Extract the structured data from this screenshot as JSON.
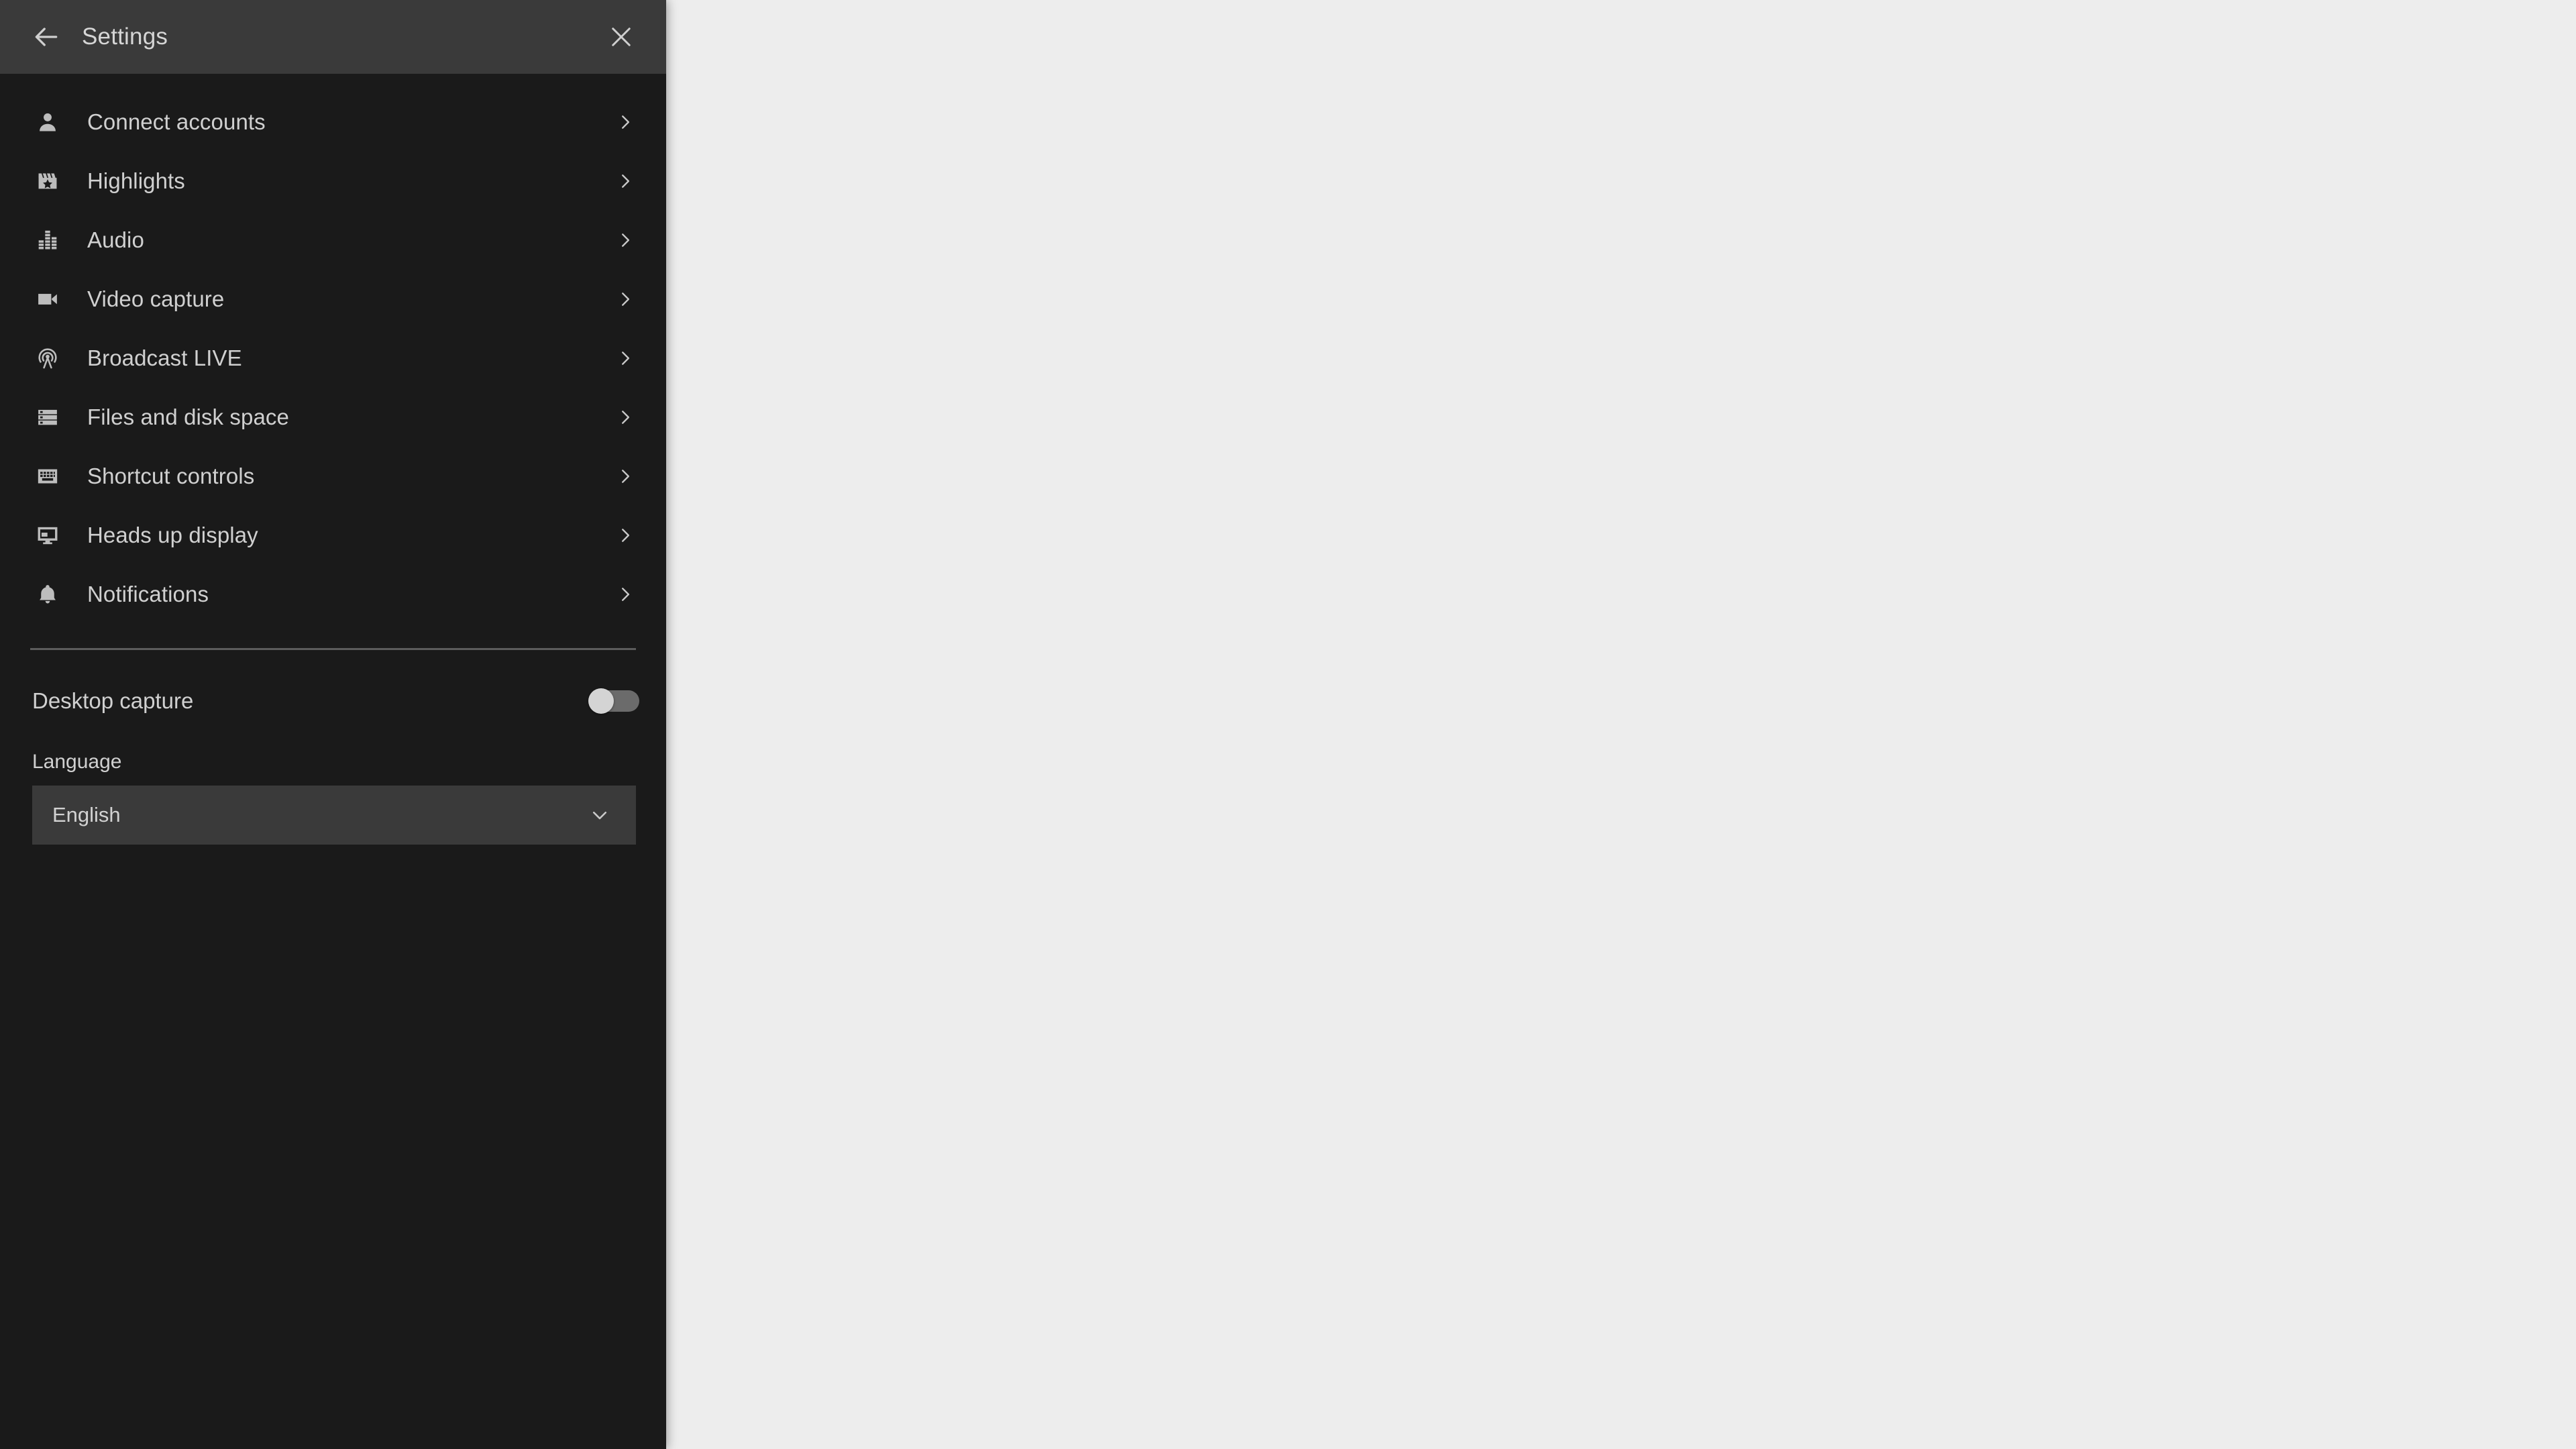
{
  "app": {
    "panel_title": "Settings",
    "background_color": "#ededed",
    "panel_color": "#1a1a1a",
    "header_color": "#3a3a3a",
    "text_color": "#d0d0d0",
    "field_color": "#3a3a3a"
  },
  "header": {
    "title": "Settings",
    "back_icon": "arrow-left-icon",
    "close_icon": "close-icon"
  },
  "menu": {
    "items": [
      {
        "label": "Connect accounts",
        "icon": "person-icon",
        "chevron": "chevron-right-icon"
      },
      {
        "label": "Highlights",
        "icon": "clapperboard-star-icon",
        "chevron": "chevron-right-icon"
      },
      {
        "label": "Audio",
        "icon": "equalizer-icon",
        "chevron": "chevron-right-icon"
      },
      {
        "label": "Video capture",
        "icon": "video-camera-icon",
        "chevron": "chevron-right-icon"
      },
      {
        "label": "Broadcast LIVE",
        "icon": "broadcast-icon",
        "chevron": "chevron-right-icon"
      },
      {
        "label": "Files and disk space",
        "icon": "storage-icon",
        "chevron": "chevron-right-icon"
      },
      {
        "label": "Shortcut controls",
        "icon": "keyboard-icon",
        "chevron": "chevron-right-icon"
      },
      {
        "label": "Heads up display",
        "icon": "monitor-icon",
        "chevron": "chevron-right-icon"
      },
      {
        "label": "Notifications",
        "icon": "bell-icon",
        "chevron": "chevron-right-icon"
      }
    ]
  },
  "desktop_capture": {
    "label": "Desktop capture",
    "enabled": false,
    "toggle_track_color": "#6b6b6b",
    "toggle_knob_color": "#d4d4d4"
  },
  "language": {
    "label": "Language",
    "selected": "English",
    "caret_icon": "chevron-down-icon"
  }
}
